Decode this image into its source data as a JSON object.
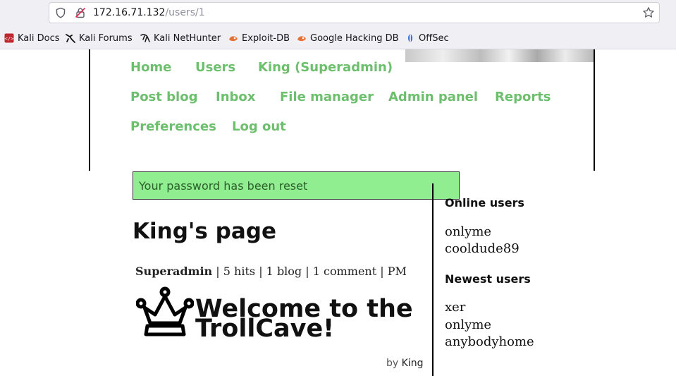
{
  "browser": {
    "url_host": "172.16.71.132",
    "url_path": "/users/1",
    "bookmarks": [
      {
        "label": "Kali Docs",
        "icon": "kali-docs-icon"
      },
      {
        "label": "Kali Forums",
        "icon": "kali-dragon-icon"
      },
      {
        "label": "Kali NetHunter",
        "icon": "kali-dragon-icon"
      },
      {
        "label": "Exploit-DB",
        "icon": "exploitdb-icon"
      },
      {
        "label": "Google Hacking DB",
        "icon": "exploitdb-icon"
      },
      {
        "label": "OffSec",
        "icon": "offsec-icon"
      }
    ]
  },
  "nav": {
    "items": [
      {
        "label": "Home"
      },
      {
        "label": "Users"
      },
      {
        "label": "King (Superadmin)"
      },
      {
        "label": "Post blog"
      },
      {
        "label": "Inbox"
      },
      {
        "label": "File manager"
      },
      {
        "label": "Admin panel"
      },
      {
        "label": "Reports"
      },
      {
        "label": "Preferences"
      },
      {
        "label": "Log out"
      }
    ]
  },
  "flash": {
    "message": "Your password has been reset"
  },
  "profile": {
    "title": "King's page",
    "role": "Superadmin",
    "hits": "5 hits",
    "blogs": "1 blog",
    "comments": "1 comment",
    "pm": "PM",
    "separator": "|",
    "welcome": "Welcome to the TrollCave!",
    "by_prefix": "by",
    "author": "King"
  },
  "sidebar": {
    "online_heading": "Online users",
    "online_users": [
      "onlyme",
      "cooldude89"
    ],
    "newest_heading": "Newest users",
    "newest_users": [
      "xer",
      "onlyme",
      "anybodyhome"
    ]
  },
  "colors": {
    "link": "#6cbf6c",
    "flash_bg": "#90ee90",
    "flash_text": "#2b5e2b"
  }
}
